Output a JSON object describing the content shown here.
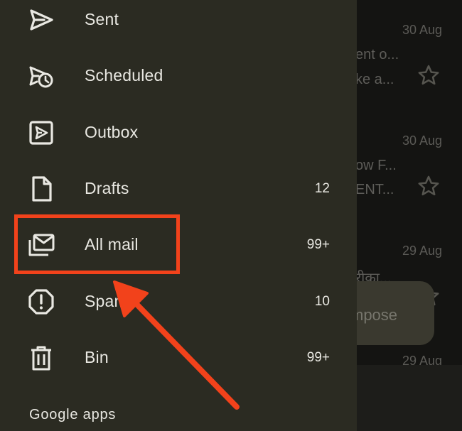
{
  "background_list": {
    "items": [
      {
        "date": "30 Aug",
        "line1": "ent o...",
        "line2": "ke a..."
      },
      {
        "date": "30 Aug",
        "line1": "ow F...",
        "line2": "ENT..."
      },
      {
        "date": "29 Aug",
        "line1": "रीका...",
        "line2": ""
      },
      {
        "date": "29 Aug",
        "line1": "",
        "line2": ""
      }
    ],
    "compose_label": "mpose"
  },
  "drawer": {
    "items": [
      {
        "label": "Sent",
        "count": "",
        "icon": "send-icon"
      },
      {
        "label": "Scheduled",
        "count": "",
        "icon": "scheduled-icon"
      },
      {
        "label": "Outbox",
        "count": "",
        "icon": "outbox-icon"
      },
      {
        "label": "Drafts",
        "count": "12",
        "icon": "draft-icon"
      },
      {
        "label": "All mail",
        "count": "99+",
        "icon": "all-mail-icon"
      },
      {
        "label": "Spam",
        "count": "10",
        "icon": "spam-icon"
      },
      {
        "label": "Bin",
        "count": "99+",
        "icon": "bin-icon"
      }
    ],
    "section_title": "Google apps"
  },
  "annotation": {
    "highlight_color": "#f2421b",
    "highlighted_item": "All mail"
  },
  "colors": {
    "drawer_bg": "#2b2b22",
    "text": "#e9e8e2",
    "accent": "#f2421b"
  }
}
